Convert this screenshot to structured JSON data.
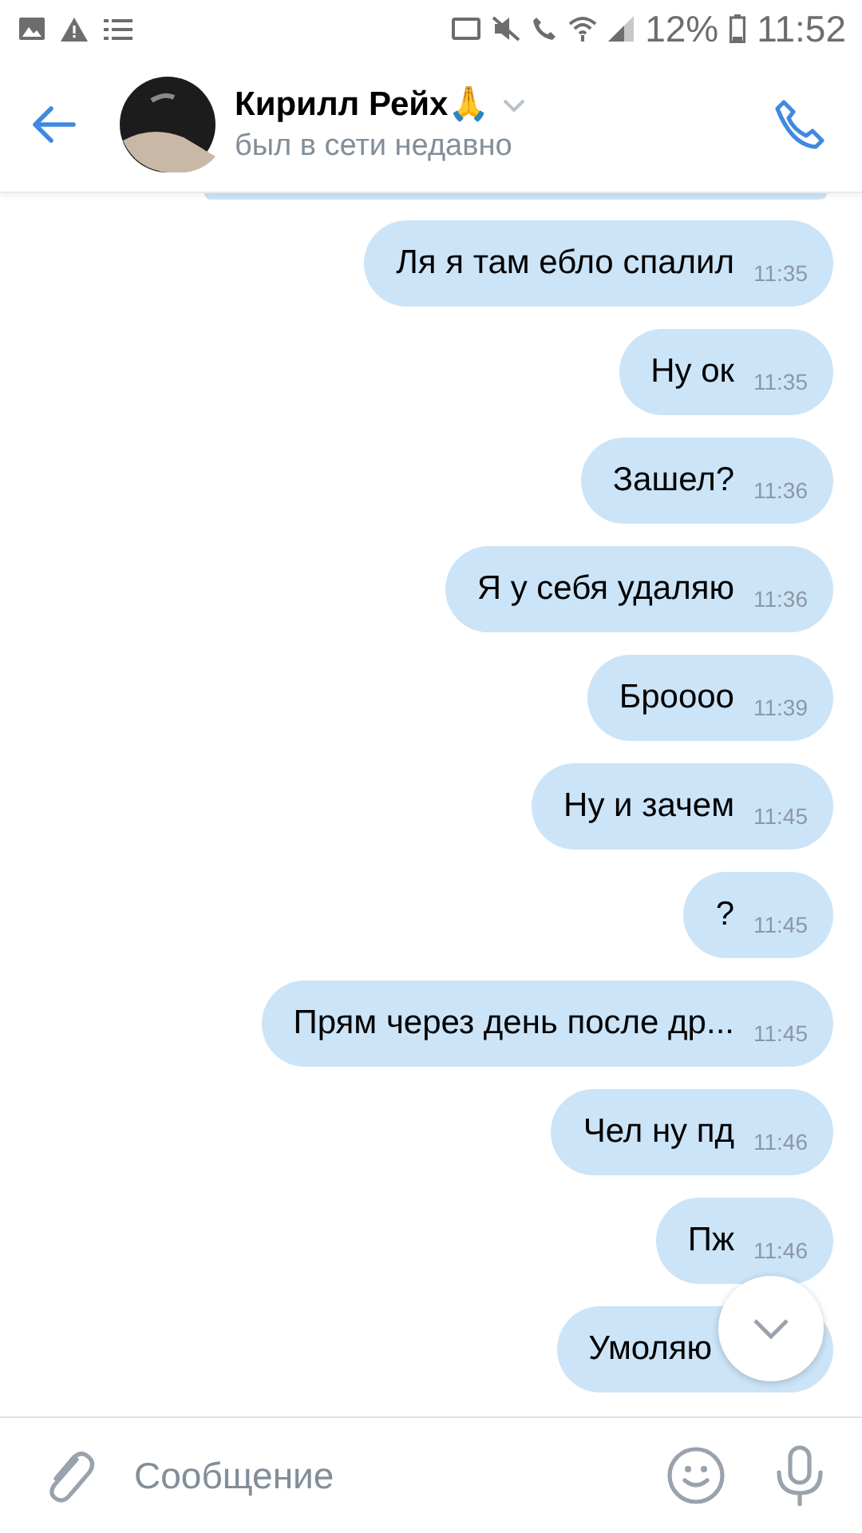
{
  "status_bar": {
    "battery": "12%",
    "time": "11:52"
  },
  "header": {
    "name": "Кирилл Рейх🙏",
    "status": "был в сети недавно"
  },
  "messages": [
    {
      "text": "Ля я там ебло спалил",
      "time": "11:35"
    },
    {
      "text": "Ну ок",
      "time": "11:35"
    },
    {
      "text": "Зашел?",
      "time": "11:36"
    },
    {
      "text": "Я у себя удаляю",
      "time": "11:36"
    },
    {
      "text": "Броооо",
      "time": "11:39"
    },
    {
      "text": "Ну и зачем",
      "time": "11:45"
    },
    {
      "text": "?",
      "time": "11:45"
    },
    {
      "text": "Прям через день после др...",
      "time": "11:45"
    },
    {
      "text": "Чел ну пд",
      "time": "11:46"
    },
    {
      "text": "Пж",
      "time": "11:46"
    },
    {
      "text": "Умоляю"
    }
  ],
  "composer": {
    "placeholder": "Сообщение"
  }
}
